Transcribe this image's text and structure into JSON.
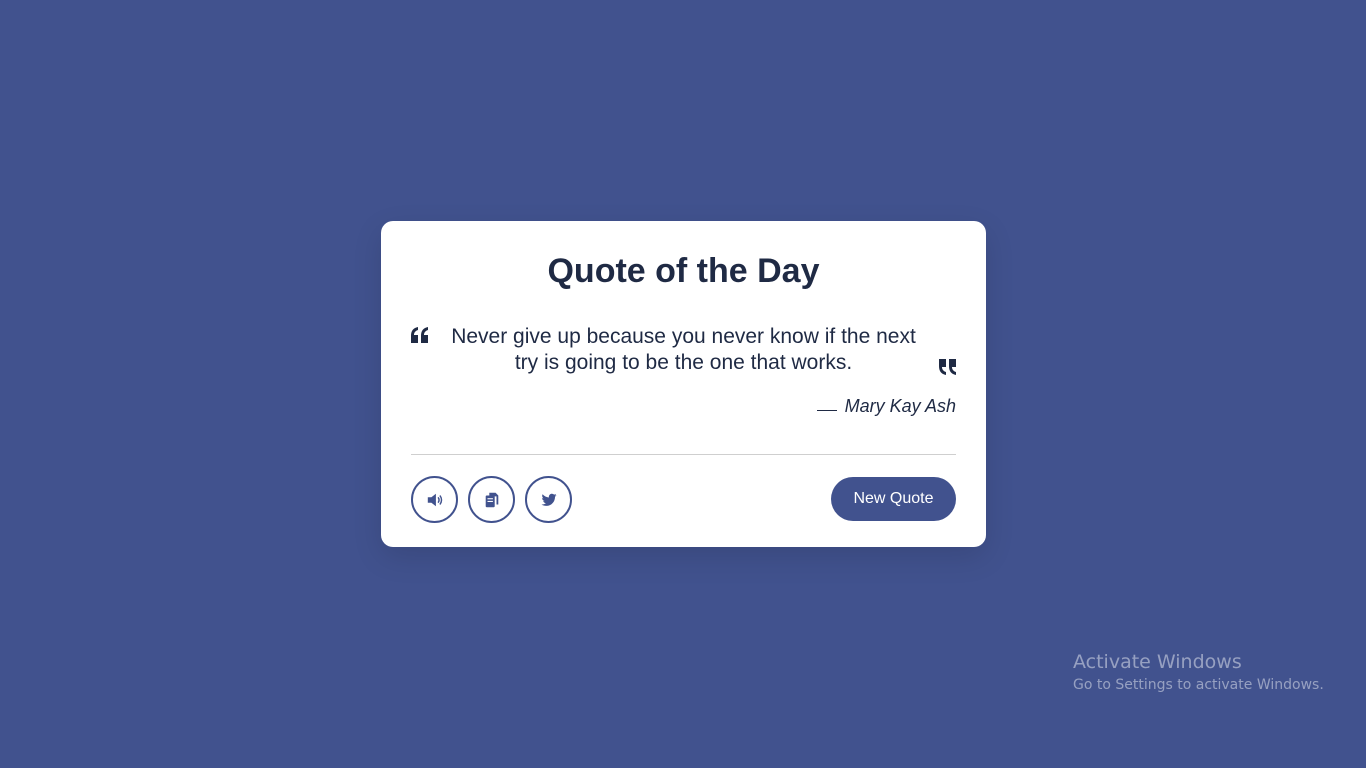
{
  "card": {
    "title": "Quote of the Day",
    "quote": "Never give up because you never know if the next try is going to be the one that works.",
    "author": "Mary Kay Ash"
  },
  "actions": {
    "speak_icon": "speaker-icon",
    "copy_icon": "copy-icon",
    "twitter_icon": "twitter-icon",
    "new_quote_label": "New Quote"
  },
  "watermark": {
    "title": "Activate Windows",
    "subtitle": "Go to Settings to activate Windows."
  },
  "colors": {
    "background": "#41528e",
    "accent": "#41528e",
    "text": "#1f2a44"
  }
}
